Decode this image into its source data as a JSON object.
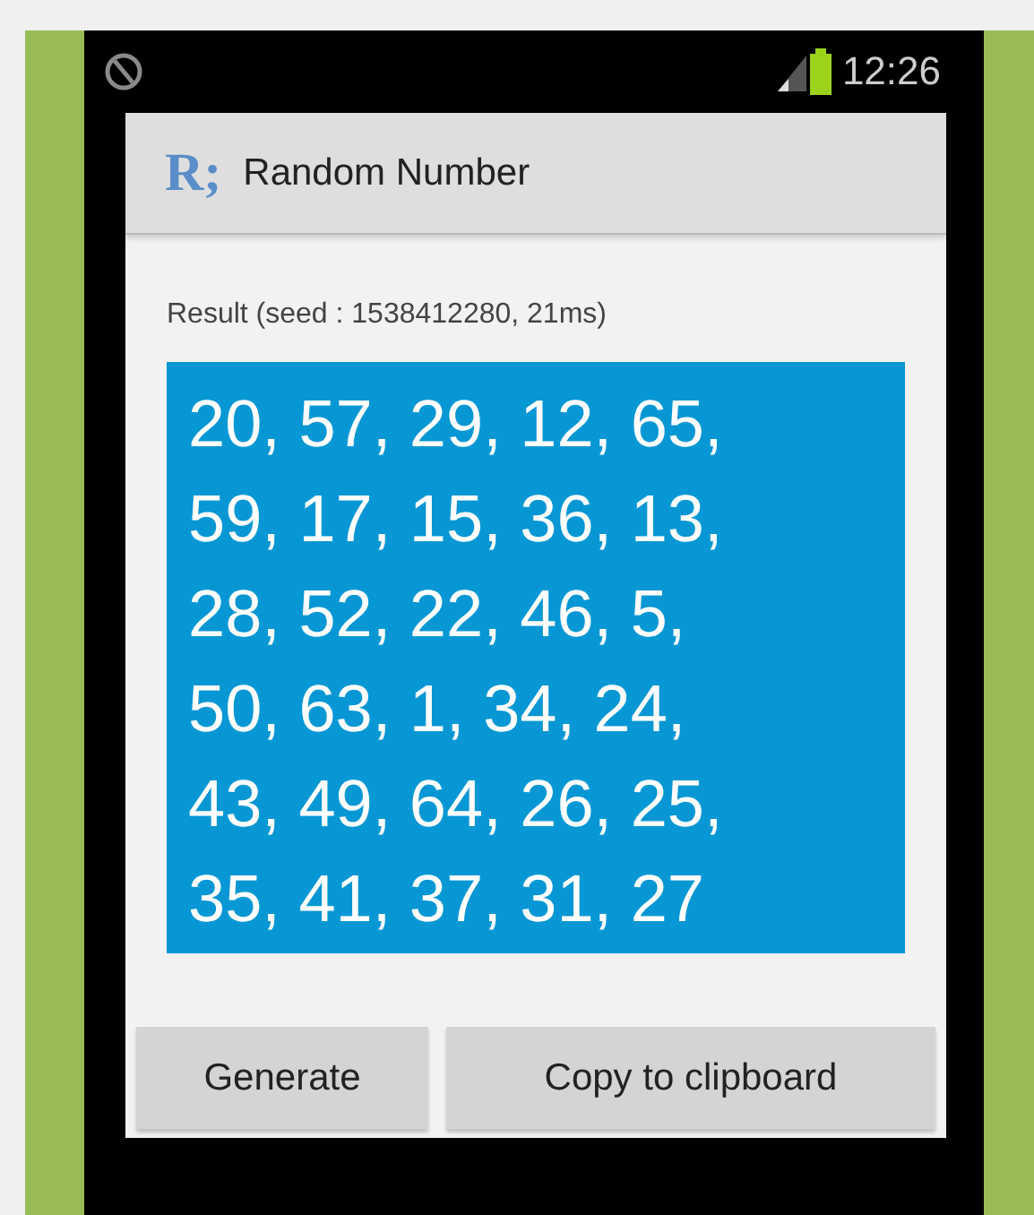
{
  "status_bar": {
    "time": "12:26"
  },
  "app_bar": {
    "logo": "R;",
    "title": "Random Number"
  },
  "result": {
    "label": "Result (seed : 1538412280, 21ms)",
    "lines": [
      "20, 57, 29, 12, 65,",
      "59, 17, 15, 36, 13,",
      "28, 52, 22, 46, 5,",
      "50, 63, 1, 34, 24,",
      "43, 49, 64, 26, 25,",
      "35, 41, 37, 31, 27"
    ]
  },
  "buttons": [
    {
      "label": "Generate",
      "kind": "generate"
    },
    {
      "label": "Copy to clipboard",
      "kind": "copy"
    }
  ]
}
